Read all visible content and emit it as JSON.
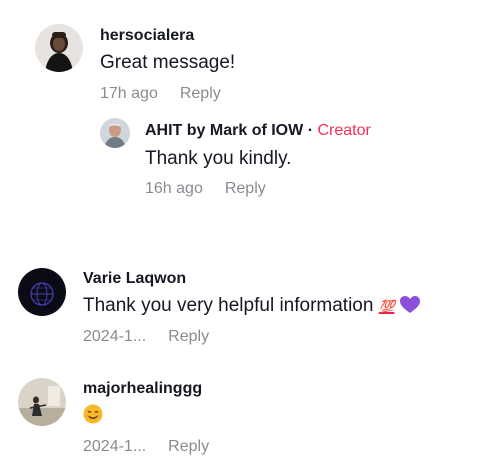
{
  "comments": [
    {
      "username": "hersocialera",
      "text": "Great message!",
      "time": "17h ago",
      "reply_label": "Reply",
      "avatar_icon": "profile-photo-woman",
      "replies": [
        {
          "username": "AHIT by Mark of IOW",
          "separator": "·",
          "badge": "Creator",
          "text": "Thank you kindly.",
          "time": "16h ago",
          "reply_label": "Reply",
          "avatar_icon": "profile-photo-man"
        }
      ]
    },
    {
      "username": "Varie Laqwon",
      "text": "Thank you very helpful information",
      "emoji_100": "💯",
      "emoji_heart": "purple-heart-icon",
      "time": "2024-1...",
      "reply_label": "Reply",
      "avatar_icon": "profile-photo-dark-globe"
    },
    {
      "username": "majorhealinggg",
      "emoji_smile": "smiling-face-icon",
      "time": "2024-1...",
      "reply_label": "Reply",
      "avatar_icon": "profile-photo-room"
    }
  ],
  "colors": {
    "text": "#161823",
    "muted": "#8a8b91",
    "creator": "#fe2c55",
    "heart": "#8b4fd8"
  }
}
